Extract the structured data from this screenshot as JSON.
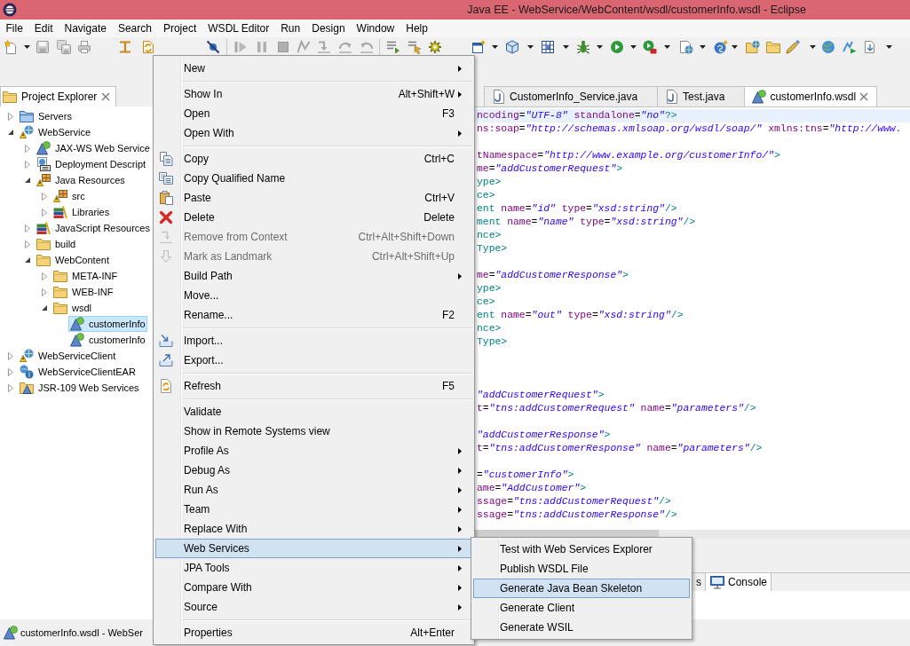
{
  "window": {
    "title": "Java EE - WebService/WebContent/wsdl/customerInfo.wsdl - Eclipse"
  },
  "menu_bar": [
    "File",
    "Edit",
    "Navigate",
    "Search",
    "Project",
    "WSDL Editor",
    "Run",
    "Design",
    "Window",
    "Help"
  ],
  "project_explorer": {
    "title": "Project Explorer",
    "tree": [
      {
        "label": "Servers",
        "kind": "server_folder",
        "expanded": false,
        "selected": false
      },
      {
        "label": "WebService",
        "kind": "project",
        "expanded": true,
        "selected": false,
        "children": [
          {
            "label": "JAX-WS Web Service",
            "kind": "services",
            "expanded": false,
            "selected": false
          },
          {
            "label": "Deployment Descript",
            "kind": "descriptor",
            "expanded": false,
            "selected": false
          },
          {
            "label": "Java Resources",
            "kind": "java_resources",
            "expanded": true,
            "selected": false,
            "children": [
              {
                "label": "src",
                "kind": "source_folder",
                "expanded": false,
                "selected": false
              },
              {
                "label": "Libraries",
                "kind": "library",
                "expanded": false,
                "selected": false
              }
            ]
          },
          {
            "label": "JavaScript Resources",
            "kind": "library",
            "expanded": false,
            "selected": false
          },
          {
            "label": "build",
            "kind": "folder",
            "expanded": false,
            "selected": false
          },
          {
            "label": "WebContent",
            "kind": "folder",
            "expanded": true,
            "selected": false,
            "children": [
              {
                "label": "META-INF",
                "kind": "folder",
                "expanded": false,
                "selected": false
              },
              {
                "label": "WEB-INF",
                "kind": "folder",
                "expanded": false,
                "selected": false
              },
              {
                "label": "wsdl",
                "kind": "folder",
                "expanded": true,
                "selected": false,
                "children": [
                  {
                    "label": "customerInfo",
                    "kind": "wsdl_file",
                    "selected": true
                  },
                  {
                    "label": "customerInfo",
                    "kind": "wsdl_file",
                    "selected": false
                  }
                ]
              }
            ]
          }
        ]
      },
      {
        "label": "WebServiceClient",
        "kind": "project",
        "expanded": false,
        "selected": false
      },
      {
        "label": "WebServiceClientEAR",
        "kind": "ear_project",
        "expanded": false,
        "selected": false
      },
      {
        "label": "JSR-109 Web Services",
        "kind": "web_services",
        "expanded": false,
        "selected": false
      }
    ]
  },
  "editor": {
    "tabs": [
      {
        "label": "CustomerInfo_Service.java",
        "kind": "java",
        "selected": false
      },
      {
        "label": "Test.java",
        "kind": "java",
        "selected": false
      },
      {
        "label": "customerInfo.wsdl",
        "kind": "wsdl",
        "selected": true
      }
    ],
    "lines": [
      {
        "current": true,
        "segments": [
          {
            "kind": "attr",
            "text": "ncoding"
          },
          {
            "kind": "eq",
            "text": "="
          },
          {
            "kind": "value",
            "text": "\"UTF-8\""
          },
          {
            "kind": "attr",
            "text": " standalone"
          },
          {
            "kind": "eq",
            "text": "="
          },
          {
            "kind": "value",
            "text": "\"no\""
          },
          {
            "kind": "tag",
            "text": "?>"
          }
        ]
      },
      {
        "current": false,
        "segments": [
          {
            "kind": "attr",
            "text": "ns:soap"
          },
          {
            "kind": "eq",
            "text": "="
          },
          {
            "kind": "value",
            "text": "\"http://schemas.xmlsoap.org/wsdl/soap/\""
          },
          {
            "kind": "attr",
            "text": " xmlns:tns"
          },
          {
            "kind": "eq",
            "text": "="
          },
          {
            "kind": "value",
            "text": "\"http://www."
          }
        ]
      },
      {
        "current": false
      },
      {
        "current": false,
        "segments": [
          {
            "kind": "attr",
            "text": "tNamespace"
          },
          {
            "kind": "eq",
            "text": "="
          },
          {
            "kind": "value",
            "text": "\"http://www.example.org/customerInfo/\""
          },
          {
            "kind": "tag",
            "text": ">"
          }
        ]
      },
      {
        "current": false,
        "segments": [
          {
            "kind": "attr",
            "text": "me"
          },
          {
            "kind": "eq",
            "text": "="
          },
          {
            "kind": "value",
            "text": "\"addCustomerRequest\""
          },
          {
            "kind": "tag",
            "text": ">"
          }
        ]
      },
      {
        "current": false,
        "segments": [
          {
            "kind": "tag",
            "text": "ype>"
          }
        ]
      },
      {
        "current": false,
        "segments": [
          {
            "kind": "tag",
            "text": "ce>"
          }
        ]
      },
      {
        "current": false,
        "segments": [
          {
            "kind": "tag",
            "text": "ent"
          },
          {
            "kind": "attr",
            "text": " name"
          },
          {
            "kind": "eq",
            "text": "="
          },
          {
            "kind": "value",
            "text": "\"id\""
          },
          {
            "kind": "attr",
            "text": " type"
          },
          {
            "kind": "eq",
            "text": "="
          },
          {
            "kind": "value",
            "text": "\"xsd:string\""
          },
          {
            "kind": "tag",
            "text": "/>"
          }
        ]
      },
      {
        "current": false,
        "segments": [
          {
            "kind": "tag",
            "text": "ment"
          },
          {
            "kind": "attr",
            "text": " name"
          },
          {
            "kind": "eq",
            "text": "="
          },
          {
            "kind": "value",
            "text": "\"name\""
          },
          {
            "kind": "attr",
            "text": " type"
          },
          {
            "kind": "eq",
            "text": "="
          },
          {
            "kind": "value",
            "text": "\"xsd:string\""
          },
          {
            "kind": "tag",
            "text": "/>"
          }
        ]
      },
      {
        "current": false,
        "segments": [
          {
            "kind": "tag",
            "text": "nce>"
          }
        ]
      },
      {
        "current": false,
        "segments": [
          {
            "kind": "tag",
            "text": "Type>"
          }
        ]
      },
      {
        "current": false
      },
      {
        "current": false,
        "segments": [
          {
            "kind": "attr",
            "text": "me"
          },
          {
            "kind": "eq",
            "text": "="
          },
          {
            "kind": "value",
            "text": "\"addCustomerResponse\""
          },
          {
            "kind": "tag",
            "text": ">"
          }
        ]
      },
      {
        "current": false,
        "segments": [
          {
            "kind": "tag",
            "text": "ype>"
          }
        ]
      },
      {
        "current": false,
        "segments": [
          {
            "kind": "tag",
            "text": "ce>"
          }
        ]
      },
      {
        "current": false,
        "segments": [
          {
            "kind": "tag",
            "text": "ent"
          },
          {
            "kind": "attr",
            "text": " name"
          },
          {
            "kind": "eq",
            "text": "="
          },
          {
            "kind": "value",
            "text": "\"out\""
          },
          {
            "kind": "attr",
            "text": " type"
          },
          {
            "kind": "eq",
            "text": "="
          },
          {
            "kind": "value",
            "text": "\"xsd:string\""
          },
          {
            "kind": "tag",
            "text": "/>"
          }
        ]
      },
      {
        "current": false,
        "segments": [
          {
            "kind": "tag",
            "text": "nce>"
          }
        ]
      },
      {
        "current": false,
        "segments": [
          {
            "kind": "tag",
            "text": "Type>"
          }
        ]
      },
      {
        "current": false
      },
      {
        "current": false
      },
      {
        "current": false
      },
      {
        "current": false,
        "segments": [
          {
            "kind": "value",
            "text": "\"addCustomerRequest\""
          },
          {
            "kind": "tag",
            "text": ">"
          }
        ]
      },
      {
        "current": false,
        "segments": [
          {
            "kind": "attr",
            "text": "t"
          },
          {
            "kind": "eq",
            "text": "="
          },
          {
            "kind": "value",
            "text": "\"tns:addCustomerRequest\""
          },
          {
            "kind": "attr",
            "text": " name"
          },
          {
            "kind": "eq",
            "text": "="
          },
          {
            "kind": "value",
            "text": "\"parameters\""
          },
          {
            "kind": "tag",
            "text": "/>"
          }
        ]
      },
      {
        "current": false
      },
      {
        "current": false,
        "segments": [
          {
            "kind": "value",
            "text": "\"addCustomerResponse\""
          },
          {
            "kind": "tag",
            "text": ">"
          }
        ]
      },
      {
        "current": false,
        "segments": [
          {
            "kind": "attr",
            "text": "t"
          },
          {
            "kind": "eq",
            "text": "="
          },
          {
            "kind": "value",
            "text": "\"tns:addCustomerResponse\""
          },
          {
            "kind": "attr",
            "text": " name"
          },
          {
            "kind": "eq",
            "text": "="
          },
          {
            "kind": "value",
            "text": "\"parameters\""
          },
          {
            "kind": "tag",
            "text": "/>"
          }
        ]
      },
      {
        "current": false
      },
      {
        "current": false,
        "segments": [
          {
            "kind": "eq",
            "text": "="
          },
          {
            "kind": "value",
            "text": "\"customerInfo\""
          },
          {
            "kind": "tag",
            "text": ">"
          }
        ]
      },
      {
        "current": false,
        "segments": [
          {
            "kind": "attr",
            "text": "ame"
          },
          {
            "kind": "eq",
            "text": "="
          },
          {
            "kind": "value",
            "text": "\"AddCustomer\""
          },
          {
            "kind": "tag",
            "text": ">"
          }
        ]
      },
      {
        "current": false,
        "segments": [
          {
            "kind": "attr",
            "text": "ssage"
          },
          {
            "kind": "eq",
            "text": "="
          },
          {
            "kind": "value",
            "text": "\"tns:addCustomerRequest\""
          },
          {
            "kind": "tag",
            "text": "/>"
          }
        ]
      },
      {
        "current": false,
        "segments": [
          {
            "kind": "attr",
            "text": "ssage"
          },
          {
            "kind": "eq",
            "text": "="
          },
          {
            "kind": "value",
            "text": "\"tns:addCustomerResponse\""
          },
          {
            "kind": "tag",
            "text": "/>"
          }
        ]
      }
    ]
  },
  "bottom_panel": {
    "tabs": [
      {
        "label": "s",
        "kind": "plain",
        "selected": false
      },
      {
        "label": "Console",
        "kind": "console",
        "selected": true
      }
    ]
  },
  "status_bar": {
    "text": "customerInfo.wsdl - WebSer"
  },
  "context_menu": {
    "groups": [
      [
        {
          "label": "New",
          "submenu": true,
          "disabled": false,
          "selected": false
        }
      ],
      [
        {
          "label": "Show In",
          "shortcut": "Alt+Shift+W",
          "submenu": true,
          "disabled": false,
          "selected": false
        },
        {
          "label": "Open",
          "shortcut": "F3",
          "submenu": false,
          "disabled": false,
          "selected": false
        },
        {
          "label": "Open With",
          "submenu": true,
          "disabled": false,
          "selected": false
        }
      ],
      [
        {
          "label": "Copy",
          "shortcut": "Ctrl+C",
          "submenu": false,
          "disabled": false,
          "selected": false
        },
        {
          "label": "Copy Qualified Name",
          "submenu": false,
          "disabled": false,
          "selected": false
        },
        {
          "label": "Paste",
          "shortcut": "Ctrl+V",
          "submenu": false,
          "disabled": false,
          "selected": false
        },
        {
          "label": "Delete",
          "shortcut": "Delete",
          "submenu": false,
          "disabled": false,
          "selected": false
        },
        {
          "label": "Remove from Context",
          "shortcut": "Ctrl+Alt+Shift+Down",
          "submenu": false,
          "disabled": true,
          "selected": false
        },
        {
          "label": "Mark as Landmark",
          "shortcut": "Ctrl+Alt+Shift+Up",
          "submenu": false,
          "disabled": true,
          "selected": false
        },
        {
          "label": "Build Path",
          "submenu": true,
          "disabled": false,
          "selected": false
        },
        {
          "label": "Move...",
          "submenu": false,
          "disabled": false,
          "selected": false
        },
        {
          "label": "Rename...",
          "shortcut": "F2",
          "submenu": false,
          "disabled": false,
          "selected": false
        }
      ],
      [
        {
          "label": "Import...",
          "submenu": false,
          "disabled": false,
          "selected": false
        },
        {
          "label": "Export...",
          "submenu": false,
          "disabled": false,
          "selected": false
        }
      ],
      [
        {
          "label": "Refresh",
          "shortcut": "F5",
          "submenu": false,
          "disabled": false,
          "selected": false
        }
      ],
      [
        {
          "label": "Validate",
          "submenu": false,
          "disabled": false,
          "selected": false
        },
        {
          "label": "Show in Remote Systems view",
          "submenu": false,
          "disabled": false,
          "selected": false
        },
        {
          "label": "Profile As",
          "submenu": true,
          "disabled": false,
          "selected": false
        },
        {
          "label": "Debug As",
          "submenu": true,
          "disabled": false,
          "selected": false
        },
        {
          "label": "Run As",
          "submenu": true,
          "disabled": false,
          "selected": false
        },
        {
          "label": "Team",
          "submenu": true,
          "disabled": false,
          "selected": false
        },
        {
          "label": "Replace With",
          "submenu": true,
          "disabled": false,
          "selected": false
        },
        {
          "label": "Web Services",
          "submenu": true,
          "disabled": false,
          "selected": true,
          "submenu_items": [
            {
              "label": "Test with Web Services Explorer",
              "selected": false
            },
            {
              "label": "Publish WSDL File",
              "selected": false
            },
            {
              "label": "Generate Java Bean Skeleton",
              "selected": true
            },
            {
              "label": "Generate Client",
              "selected": false
            },
            {
              "label": "Generate WSIL",
              "selected": false
            }
          ]
        },
        {
          "label": "JPA Tools",
          "submenu": true,
          "disabled": false,
          "selected": false
        },
        {
          "label": "Compare With",
          "submenu": true,
          "disabled": false,
          "selected": false
        },
        {
          "label": "Source",
          "submenu": true,
          "disabled": false,
          "selected": false
        }
      ],
      [
        {
          "label": "Properties",
          "shortcut": "Alt+Enter",
          "submenu": false,
          "disabled": false,
          "selected": false
        }
      ]
    ]
  }
}
